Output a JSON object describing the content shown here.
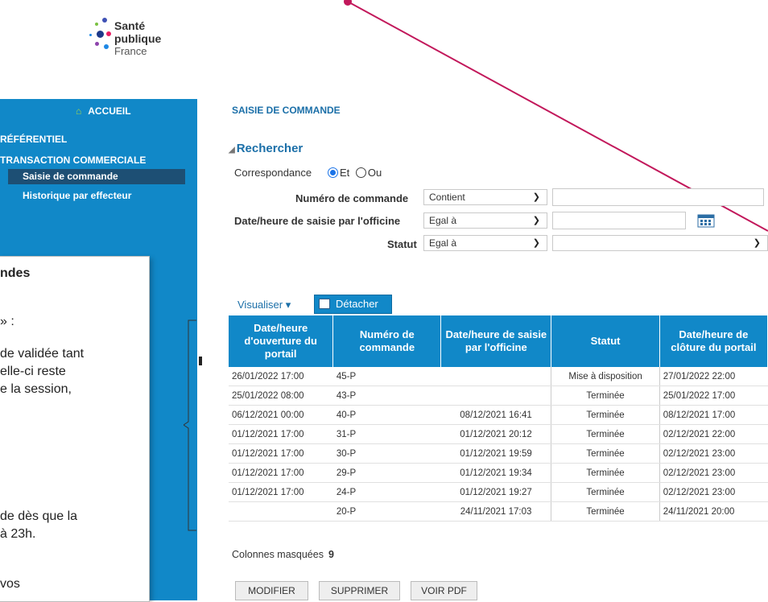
{
  "logo": {
    "line1": "Santé",
    "line2": "publique",
    "line3": "France"
  },
  "sidebar": {
    "home": "ACCUEIL",
    "sections": [
      {
        "label": "RÉFÉRENTIEL"
      },
      {
        "label": "TRANSACTION COMMERCIALE"
      }
    ],
    "items": [
      {
        "label": "Saisie de commande",
        "active": true
      },
      {
        "label": "Historique par effecteur",
        "active": false
      }
    ]
  },
  "overlay": {
    "lines": [
      "ndes",
      "» :",
      "de validée tant",
      "elle-ci reste",
      "e la session,",
      "de dès que la",
      "à 23h.",
      "vos"
    ]
  },
  "page": {
    "title": "SAISIE DE COMMANDE"
  },
  "search": {
    "heading": "Rechercher",
    "correspondance_label": "Correspondance",
    "opt_et": "Et",
    "opt_ou": "Ou",
    "fields": [
      {
        "label": "Numéro de commande",
        "operator": "Contient",
        "value": ""
      },
      {
        "label": "Date/heure de saisie par l'officine",
        "operator": "Egal à",
        "value": ""
      },
      {
        "label": "Statut",
        "operator": "Egal à",
        "value": ""
      }
    ]
  },
  "toolbar": {
    "visualiser": "Visualiser ▾",
    "detacher": "Détacher"
  },
  "table": {
    "headers": [
      "Date/heure d'ouverture du portail",
      "Numéro de commande",
      "Date/heure de saisie par l'officine",
      "Statut",
      "Date/heure de clôture du portail"
    ],
    "rows": [
      [
        "26/01/2022 17:00",
        "45-P",
        "",
        "Mise à disposition",
        "27/01/2022 22:00"
      ],
      [
        "25/01/2022 08:00",
        "43-P",
        "",
        "Terminée",
        "25/01/2022 17:00"
      ],
      [
        "06/12/2021 00:00",
        "40-P",
        "08/12/2021 16:41",
        "Terminée",
        "08/12/2021 17:00"
      ],
      [
        "01/12/2021 17:00",
        "31-P",
        "01/12/2021 20:12",
        "Terminée",
        "02/12/2021 22:00"
      ],
      [
        "01/12/2021 17:00",
        "30-P",
        "01/12/2021 19:59",
        "Terminée",
        "02/12/2021 23:00"
      ],
      [
        "01/12/2021 17:00",
        "29-P",
        "01/12/2021 19:34",
        "Terminée",
        "02/12/2021 23:00"
      ],
      [
        "01/12/2021 17:00",
        "24-P",
        "01/12/2021 19:27",
        "Terminée",
        "02/12/2021 23:00"
      ],
      [
        "",
        "20-P",
        "24/11/2021 17:03",
        "Terminée",
        "24/11/2021 20:00"
      ]
    ]
  },
  "masked": {
    "label": "Colonnes masquées",
    "count": "9"
  },
  "buttons": {
    "modify": "MODIFIER",
    "delete": "SUPPRIMER",
    "pdf": "VOIR PDF"
  },
  "colors": {
    "sidebar": "#1188c8",
    "active": "#1d4f74",
    "accent": "#1b6fa8",
    "annotation_line": "#c2185b"
  }
}
